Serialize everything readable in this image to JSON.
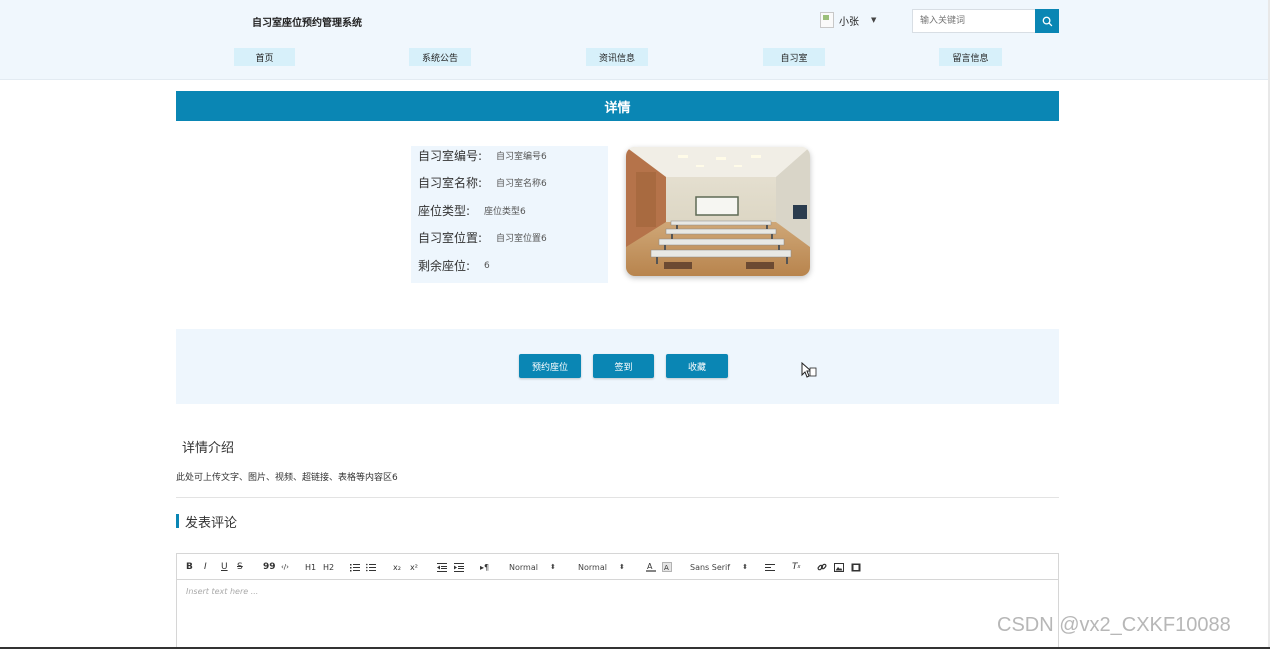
{
  "header": {
    "site_title": "自习室座位预约管理系统",
    "user_name": "小张",
    "search_placeholder": "输入关键词"
  },
  "nav": [
    {
      "label": "首页"
    },
    {
      "label": "系统公告"
    },
    {
      "label": "资讯信息"
    },
    {
      "label": "自习室"
    },
    {
      "label": "留言信息"
    }
  ],
  "detail": {
    "banner": "详情",
    "fields": [
      {
        "label": "自习室编号:",
        "value": "自习室编号6"
      },
      {
        "label": "自习室名称:",
        "value": "自习室名称6"
      },
      {
        "label": "座位类型:",
        "value": "座位类型6"
      },
      {
        "label": "自习室位置:",
        "value": "自习室位置6"
      },
      {
        "label": "剩余座位:",
        "value": "6"
      }
    ]
  },
  "actions": [
    {
      "label": "预约座位"
    },
    {
      "label": "签到"
    },
    {
      "label": "收藏"
    }
  ],
  "intro": {
    "title": "详情介绍",
    "content": "此处可上传文字、图片、视频、超链接、表格等内容区6"
  },
  "comment": {
    "title": "发表评论",
    "toolbar": {
      "header_select": "Normal",
      "size_select": "Normal",
      "font_select": "Sans Serif",
      "bold": "B",
      "italic": "I",
      "underline": "U",
      "strike": "S",
      "blockquote": "99",
      "code": "‹/›",
      "h1": "H1",
      "h2": "H2",
      "subscript": "x₂",
      "superscript": "x²",
      "direction": "▸¶"
    },
    "placeholder": "Insert text here ..."
  },
  "watermark": "CSDN @vx2_CXKF10088",
  "colors": {
    "accent": "#0a86b4",
    "header_bg": "#f0f7fd",
    "nav_bg": "#d7f0fa",
    "panel_bg": "#eef6fd"
  }
}
